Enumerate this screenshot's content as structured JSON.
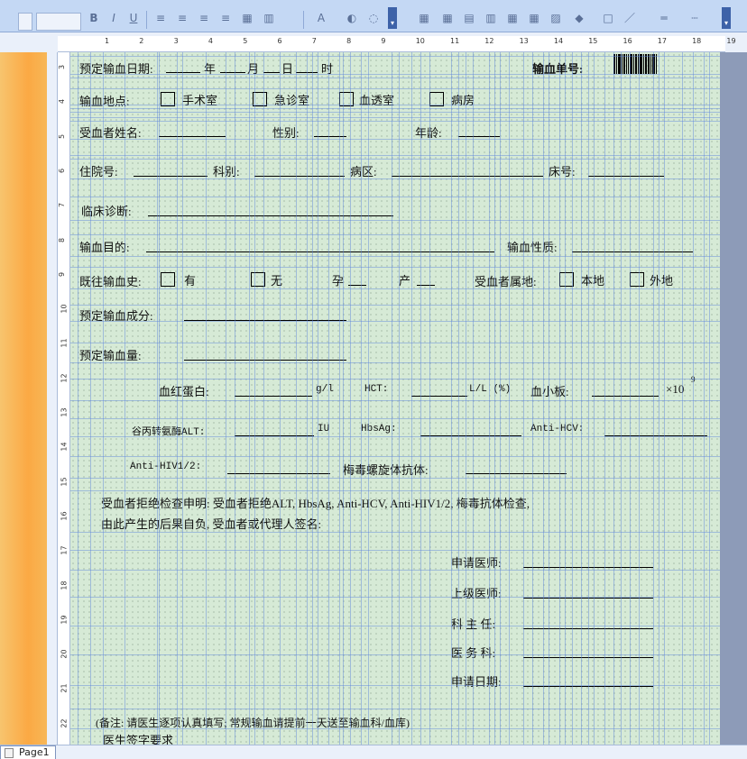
{
  "toolbar": {
    "bold": "B",
    "italic": "I",
    "underline": "U",
    "icons": [
      "align-left-icon",
      "align-center-icon",
      "align-right-icon",
      "justify-icon",
      "font-color-icon",
      "border-icon",
      "cell-icon",
      "fill-color-icon",
      "line-color-icon",
      "line-style-icon",
      "dash-style-icon"
    ]
  },
  "ruler": {
    "numbers": [
      "1",
      "2",
      "3",
      "4",
      "5",
      "6",
      "7",
      "8",
      "9",
      "10",
      "11",
      "12",
      "13",
      "14",
      "15",
      "16",
      "17",
      "18",
      "19"
    ],
    "vertical_numbers": [
      "3",
      "4",
      "5",
      "6",
      "7",
      "8",
      "9",
      "10",
      "11",
      "12",
      "13",
      "14",
      "15",
      "16",
      "17",
      "18",
      "19",
      "20",
      "21",
      "22"
    ]
  },
  "form": {
    "scheduled_date_label": "预定输血日期:",
    "year": "年",
    "month": "月",
    "day": "日",
    "hour": "时",
    "transfusion_no_label": "输血单号:",
    "location_label": "输血地点:",
    "locations": [
      "手术室",
      "急诊室",
      "血透室",
      "病房"
    ],
    "recipient_name_label": "受血者姓名:",
    "gender_label": "性别:",
    "age_label": "年龄:",
    "admission_no_label": "住院号:",
    "department_label": "科别:",
    "ward_label": "病区:",
    "bed_label": "床号:",
    "diagnosis_label": "临床诊断:",
    "purpose_label": "输血目的:",
    "nature_label": "输血性质:",
    "history_label": "既往输血史:",
    "history_yes": "有",
    "history_no": "无",
    "pregnancy": "孕",
    "birth": "产",
    "residence_label": "受血者属地:",
    "residence_local": "本地",
    "residence_other": "外地",
    "component_label": "预定输血成分:",
    "volume_label": "预定输血量:",
    "hemoglobin_label": "血红蛋白:",
    "hemoglobin_unit": "g/l",
    "hct_label": "HCT:",
    "hct_unit": "L/L (%)",
    "platelet_label": "血小板:",
    "platelet_unit": "×10",
    "platelet_exp": "9",
    "alt_label": "谷丙转氨酶ALT:",
    "alt_unit": "IU",
    "hbsag_label": "HbsAg:",
    "anti_hcv_label": "Anti-HCV:",
    "anti_hiv_label": "Anti-HIV1/2:",
    "syphilis_label": "梅毒螺旋体抗体:",
    "refusal_line1": "受血者拒绝检查申明: 受血者拒绝ALT, HbsAg, Anti-HCV, Anti-HIV1/2, 梅毒抗体检查,",
    "refusal_line2": "由此产生的后果自负, 受血者或代理人签名:",
    "doctor_label": "申请医师:",
    "senior_doctor_label": "上级医师:",
    "director_label": "科 主 任:",
    "medical_dept_label": "医 务 科:",
    "apply_date_label": "申请日期:",
    "note_line1": "(备注: 请医生逐项认真填写; 常规输血请提前一天送至输血科/血库)",
    "note_line2": "医生签字要求"
  },
  "status": {
    "page_tab": "Page1"
  }
}
